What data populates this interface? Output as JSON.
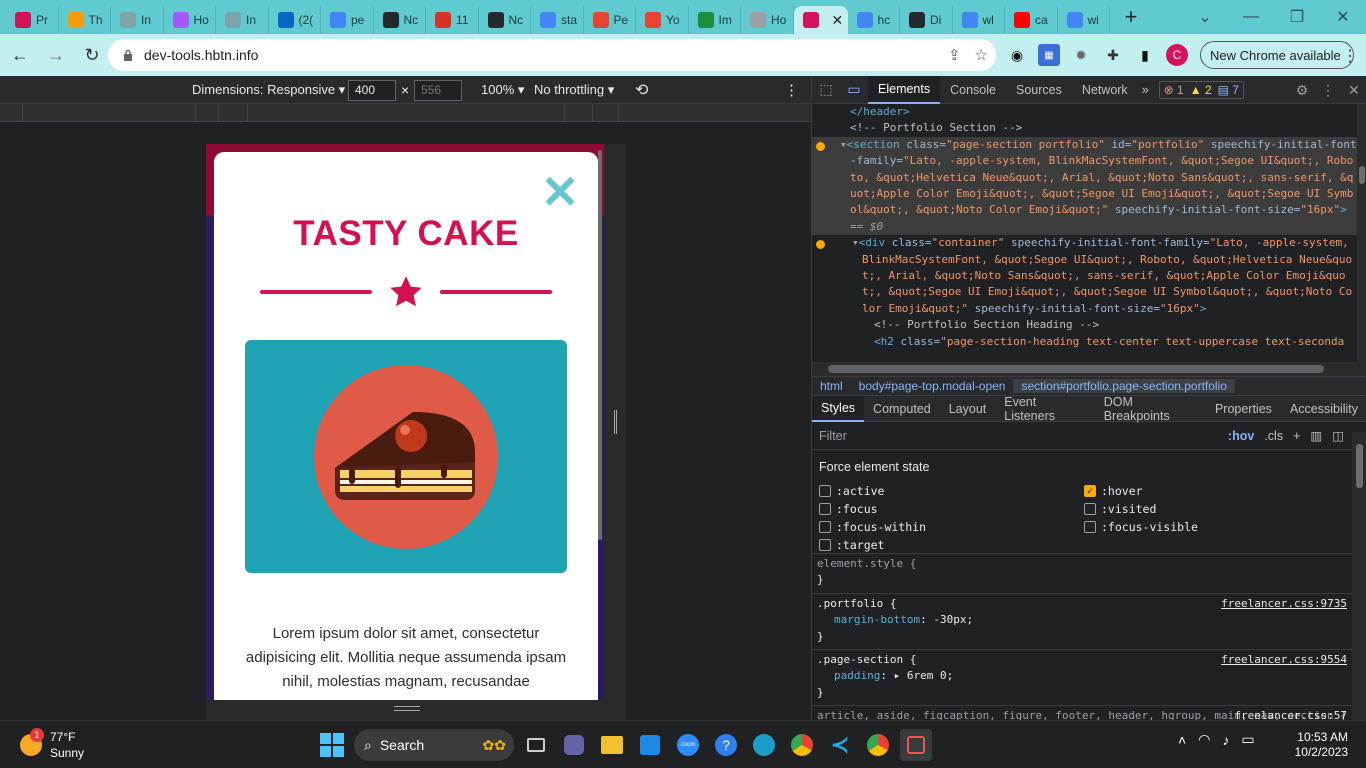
{
  "browser": {
    "tabs": [
      {
        "title": "Pr",
        "color": "#d4145a"
      },
      {
        "title": "Th",
        "color": "#f39c12"
      },
      {
        "title": "In",
        "color": "#7aa6a9"
      },
      {
        "title": "Ho",
        "color": "#a259ff"
      },
      {
        "title": "In",
        "color": "#7aa6a9"
      },
      {
        "title": "(2(",
        "color": "#0a66c2"
      },
      {
        "title": "pe",
        "color": "#4285f4"
      },
      {
        "title": "Nc",
        "color": "#24292e"
      },
      {
        "title": "11",
        "color": "#d93025"
      },
      {
        "title": "Nc",
        "color": "#24292e"
      },
      {
        "title": "sta",
        "color": "#4285f4"
      },
      {
        "title": "Pe",
        "color": "#ea4335"
      },
      {
        "title": "Yo",
        "color": "#ea4335"
      },
      {
        "title": "Im",
        "color": "#1e8e3e"
      },
      {
        "title": "Ho",
        "color": "#9aa0a6"
      },
      {
        "title": "",
        "color": "#d4145a",
        "active": true
      },
      {
        "title": "hc",
        "color": "#4285f4"
      },
      {
        "title": "Di",
        "color": "#24292e"
      },
      {
        "title": "wl",
        "color": "#4285f4"
      },
      {
        "title": "ca",
        "color": "#ff0000"
      },
      {
        "title": "wi",
        "color": "#4285f4"
      }
    ],
    "new_tab": "+",
    "url": "dev-tools.hbtn.info",
    "avatar_letter": "C",
    "new_chrome": "New Chrome available"
  },
  "device_toolbar": {
    "dimensions": "Dimensions: Responsive ▾",
    "width": "400",
    "height_placeholder": "556",
    "times": "×",
    "zoom": "100% ▾",
    "throttling": "No throttling ▾"
  },
  "page": {
    "close_glyph": "✕",
    "title": "TASTY CAKE",
    "lorem": "Lorem ipsum dolor sit amet, consectetur adipisicing elit. Mollitia neque assumenda ipsam nihil, molestias magnam, recusandae",
    "colors": {
      "title": "#d4114f",
      "image_bg": "#20a2b5",
      "plate": "#e05a48",
      "close": "#67c6cb",
      "band": "#8d0a33",
      "body": "#2c1b5e"
    }
  },
  "devtools": {
    "tabs": [
      "Elements",
      "Console",
      "Sources",
      "Network"
    ],
    "more": "»",
    "errors": "1",
    "warnings": "2",
    "info": "7",
    "dom_lines": [
      {
        "type": "tag",
        "indent": 2,
        "text": "</header>"
      },
      {
        "type": "comment",
        "indent": 2,
        "text": "<!-- Portfolio Section -->"
      },
      {
        "type": "section",
        "indent": 2,
        "text": "<section class=\"page-section portfolio\" id=\"portfolio\" speechify-initial-font-family=\"Lato, -apple-system, BlinkMacSystemFont, &quot;Segoe UI&quot;, Roboto, &quot;Helvetica Neue&quot;, Arial, &quot;Noto Sans&quot;, sans-serif, &quot;Apple Color Emoji&quot;, &quot;Segoe UI Emoji&quot;, &quot;Segoe UI Symbol&quot;, &quot;Noto Color Emoji&quot;\" speechify-initial-font-size=\"16px\">",
        "suffix": " == $0"
      },
      {
        "type": "div",
        "indent": 3,
        "text": "<div class=\"container\" speechify-initial-font-family=\"Lato, -apple-system, BlinkMacSystemFont, &quot;Segoe UI&quot;, Roboto, &quot;Helvetica Neue&quot;, Arial, &quot;Noto Sans&quot;, sans-serif, &quot;Apple Color Emoji&quot;, &quot;Segoe UI Emoji&quot;, &quot;Segoe UI Symbol&quot;, &quot;Noto Color Emoji&quot;\" speechify-initial-font-size=\"16px\">"
      },
      {
        "type": "comment",
        "indent": 4,
        "text": "<!-- Portfolio Section Heading -->"
      },
      {
        "type": "tag",
        "indent": 4,
        "text": "<h2 class=\"page-section-heading text-center text-uppercase text-seconda"
      }
    ],
    "breadcrumbs": [
      {
        "tag": "html",
        "id": ""
      },
      {
        "tag": "body",
        "id": "#page-top.modal-open"
      },
      {
        "tag": "section",
        "id": "#portfolio.page-section.portfolio"
      }
    ],
    "subtabs": [
      "Styles",
      "Computed",
      "Layout",
      "Event Listeners",
      "DOM Breakpoints",
      "Properties",
      "Accessibility"
    ],
    "filter_placeholder": "Filter",
    "hov": ":hov",
    "cls": ".cls",
    "force_title": "Force element state",
    "states": [
      {
        "label": ":active",
        "checked": false
      },
      {
        "label": ":hover",
        "checked": true
      },
      {
        "label": ":focus",
        "checked": false
      },
      {
        "label": ":visited",
        "checked": false
      },
      {
        "label": ":focus-within",
        "checked": false
      },
      {
        "label": ":focus-visible",
        "checked": false
      },
      {
        "label": ":target",
        "checked": false
      }
    ],
    "rules": [
      {
        "selector": "element.style {",
        "src": "",
        "props": [],
        "close": "}"
      },
      {
        "selector": ".portfolio {",
        "src": "freelancer.css:9735",
        "props": [
          {
            "name": "margin-bottom",
            "value": "-30px;"
          }
        ],
        "close": "}"
      },
      {
        "selector": ".page-section {",
        "src": "freelancer.css:9554",
        "props": [
          {
            "name": "padding",
            "value": "▸ 6rem 0;"
          }
        ],
        "close": "}"
      },
      {
        "selector": "article, aside, figcaption, figure, footer, header, hgroup, main, nav, section {",
        "src": "freelancer.css:57",
        "props": [],
        "close": ""
      }
    ]
  },
  "taskbar": {
    "temp": "77°F",
    "condition": "Sunny",
    "notif": "1",
    "search": "Search",
    "time": "10:53 AM",
    "date": "10/2/2023"
  }
}
